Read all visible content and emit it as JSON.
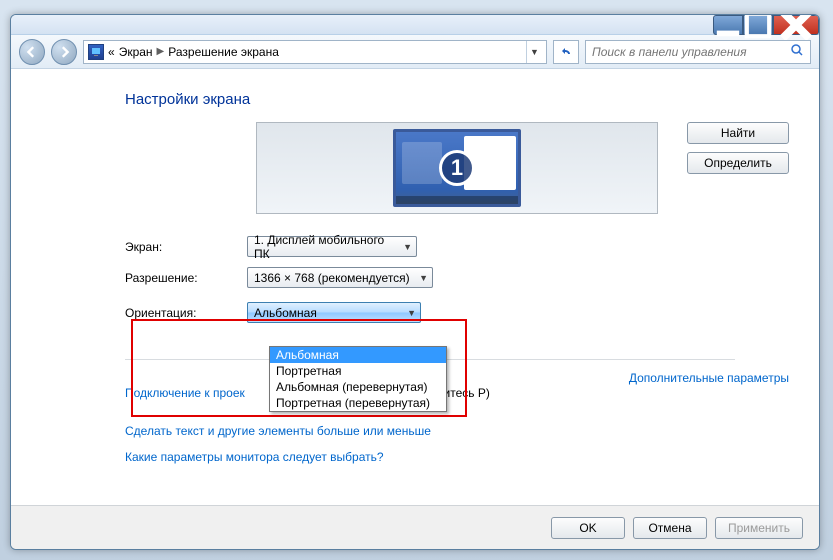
{
  "titlebar": {},
  "nav": {
    "crumb_prefix": "«",
    "crumb1": "Экран",
    "crumb2": "Разрешение экрана",
    "search_placeholder": "Поиск в панели управления"
  },
  "heading": "Настройки экрана",
  "monitor_number": "1",
  "buttons": {
    "find": "Найти",
    "detect": "Определить",
    "ok": "OK",
    "cancel": "Отмена",
    "apply": "Применить"
  },
  "labels": {
    "display": "Экран:",
    "resolution": "Разрешение:",
    "orientation": "Ориентация:"
  },
  "values": {
    "display": "1. Дисплей мобильного ПК",
    "resolution": "1366 × 768 (рекомендуется)",
    "orientation": "Альбомная"
  },
  "orientation_options": [
    "Альбомная",
    "Портретная",
    "Альбомная (перевернутая)",
    "Портретная (перевернутая)"
  ],
  "links": {
    "advanced": "Дополнительные параметры",
    "projector_pre": "Подключение к проек",
    "projector_post": "и коснитесь P)",
    "bigger_text": "Сделать текст и другие элементы больше или меньше",
    "which_monitor": "Какие параметры монитора следует выбрать?"
  }
}
